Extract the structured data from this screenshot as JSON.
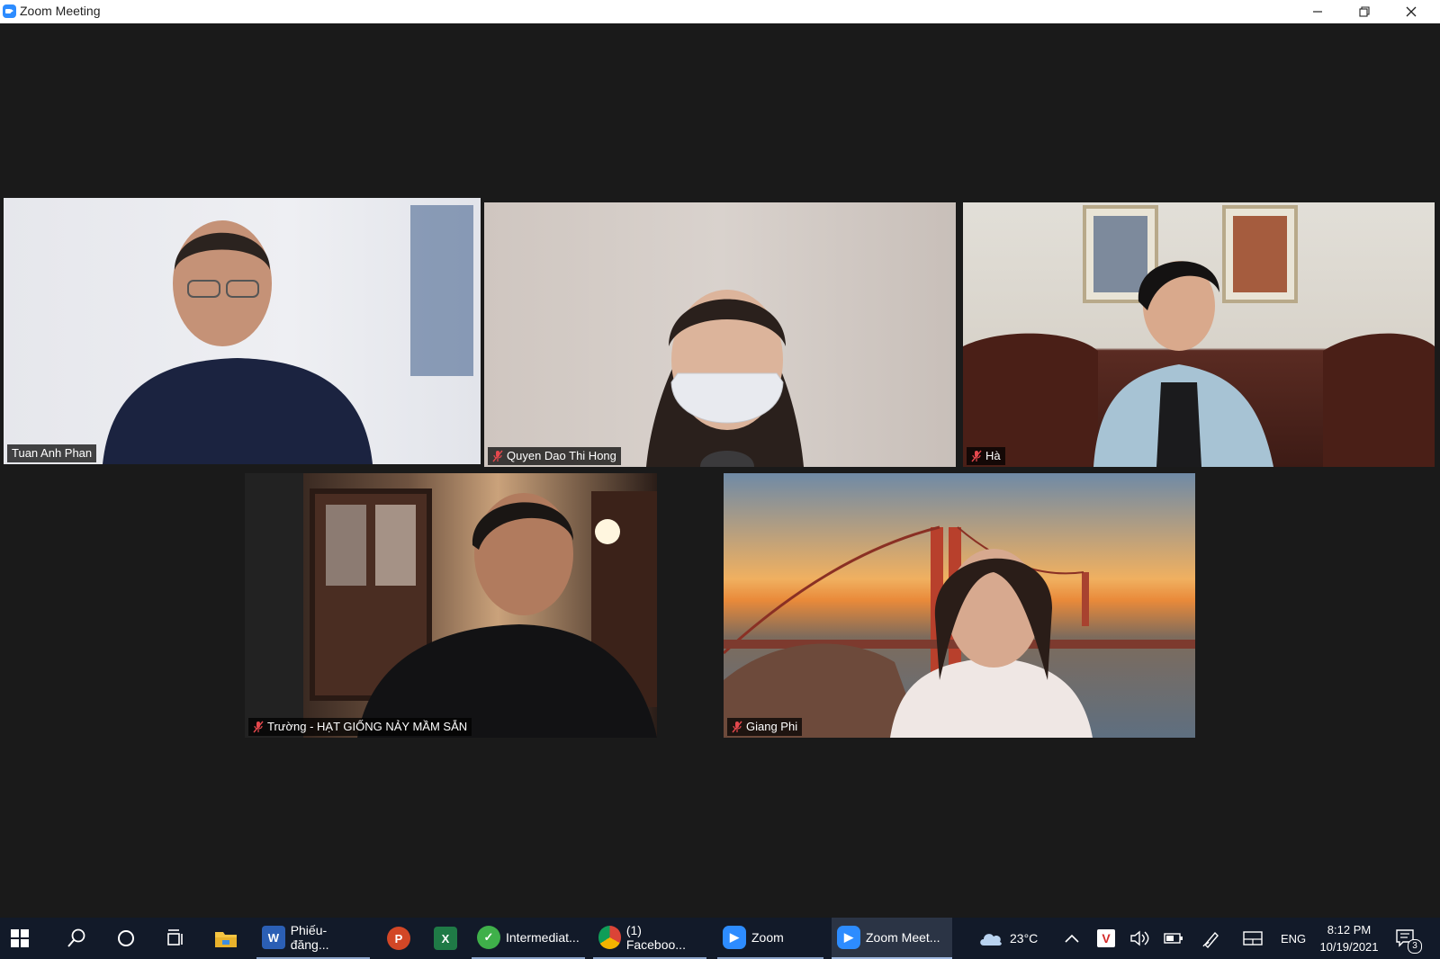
{
  "window": {
    "title": "Zoom Meeting"
  },
  "participants": [
    {
      "name": "Tuan Anh Phan",
      "muted": false,
      "active_speaker": true
    },
    {
      "name": "Quyen Dao Thi Hong",
      "muted": true
    },
    {
      "name": "Hà",
      "muted": true
    },
    {
      "name": "Trường - HẠT GIỐNG NẢY MẦM SẴN",
      "muted": true
    },
    {
      "name": "Giang Phi",
      "muted": true
    }
  ],
  "taskbar": {
    "apps": [
      {
        "icon": "word-icon",
        "label": "Phiếu-đăng..."
      },
      {
        "icon": "powerpoint-icon",
        "label": ""
      },
      {
        "icon": "excel-icon",
        "label": ""
      },
      {
        "icon": "app-green-icon",
        "label": "Intermediat..."
      },
      {
        "icon": "chrome-icon",
        "label": "(1) Faceboo..."
      },
      {
        "icon": "zoom-icon",
        "label": "Zoom"
      },
      {
        "icon": "zoom-icon",
        "label": "Zoom Meet..."
      }
    ],
    "weather": "23°C",
    "language": "ENG",
    "time": "8:12 PM",
    "date": "10/19/2021",
    "notifications": "3"
  },
  "colors": {
    "active_speaker": "#d4e86a",
    "mute": "#e5484d",
    "zoom_blue": "#2d8cff"
  }
}
